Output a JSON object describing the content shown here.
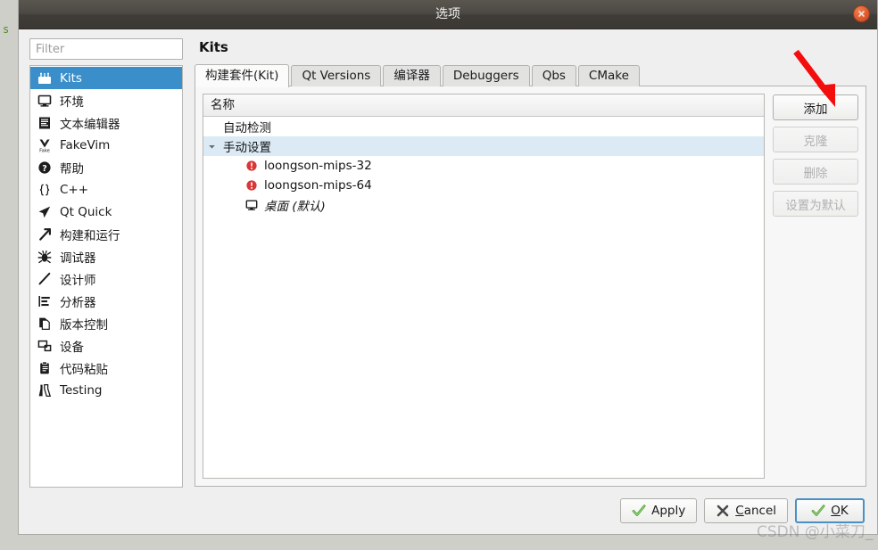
{
  "desktop": {
    "background_text": "s"
  },
  "window": {
    "title": "选项",
    "close_icon": "close-icon"
  },
  "sidebar": {
    "filter": {
      "placeholder": "Filter",
      "value": ""
    },
    "items": [
      {
        "label": "Kits",
        "icon": "kits-icon",
        "selected": true
      },
      {
        "label": "环境",
        "icon": "monitor-icon",
        "selected": false
      },
      {
        "label": "文本编辑器",
        "icon": "text-editor-icon",
        "selected": false
      },
      {
        "label": "FakeVim",
        "icon": "fakevim-icon",
        "selected": false
      },
      {
        "label": "帮助",
        "icon": "help-question-icon",
        "selected": false
      },
      {
        "label": "C++",
        "icon": "braces-icon",
        "selected": false
      },
      {
        "label": "Qt Quick",
        "icon": "paper-plane-icon",
        "selected": false
      },
      {
        "label": "构建和运行",
        "icon": "hammer-icon",
        "selected": false
      },
      {
        "label": "调试器",
        "icon": "bug-icon",
        "selected": false
      },
      {
        "label": "设计师",
        "icon": "pencil-icon",
        "selected": false
      },
      {
        "label": "分析器",
        "icon": "analyzer-icon",
        "selected": false
      },
      {
        "label": "版本控制",
        "icon": "copy-pages-icon",
        "selected": false
      },
      {
        "label": "设备",
        "icon": "devices-icon",
        "selected": false
      },
      {
        "label": "代码粘贴",
        "icon": "clipboard-icon",
        "selected": false
      },
      {
        "label": "Testing",
        "icon": "flask-icon",
        "selected": false
      }
    ]
  },
  "main": {
    "page_title": "Kits",
    "tabs": [
      {
        "label": "构建套件(Kit)",
        "active": true
      },
      {
        "label": "Qt Versions",
        "active": false
      },
      {
        "label": "编译器",
        "active": false
      },
      {
        "label": "Debuggers",
        "active": false
      },
      {
        "label": "Qbs",
        "active": false
      },
      {
        "label": "CMake",
        "active": false
      }
    ],
    "tree": {
      "column_header": "名称",
      "groups": [
        {
          "label": "自动检测",
          "expanded": false,
          "selected": false,
          "has_twisty": false,
          "children": []
        },
        {
          "label": "手动设置",
          "expanded": true,
          "selected": true,
          "has_twisty": true,
          "children": [
            {
              "label": "loongson-mips-32",
              "icon": "error-icon",
              "italic": false
            },
            {
              "label": "loongson-mips-64",
              "icon": "error-icon",
              "italic": false
            },
            {
              "label": "桌面 (默认)",
              "icon": "monitor-icon",
              "italic": true
            }
          ]
        }
      ]
    },
    "side_buttons": [
      {
        "label": "添加",
        "enabled": true
      },
      {
        "label": "克隆",
        "enabled": false
      },
      {
        "label": "删除",
        "enabled": false
      },
      {
        "label": "设置为默认",
        "enabled": false
      }
    ]
  },
  "footer": {
    "buttons": [
      {
        "label": "Apply",
        "icon": "check-icon",
        "mnemonic": "",
        "default": false
      },
      {
        "label": "Cancel",
        "icon": "cross-icon",
        "mnemonic": "C",
        "default": false
      },
      {
        "label": "OK",
        "icon": "check-icon",
        "mnemonic": "O",
        "default": true
      }
    ]
  },
  "annotations": {
    "arrow": {
      "color": "#f40d0d",
      "points_to": "添加"
    },
    "watermark": "CSDN @小菜刀_"
  }
}
